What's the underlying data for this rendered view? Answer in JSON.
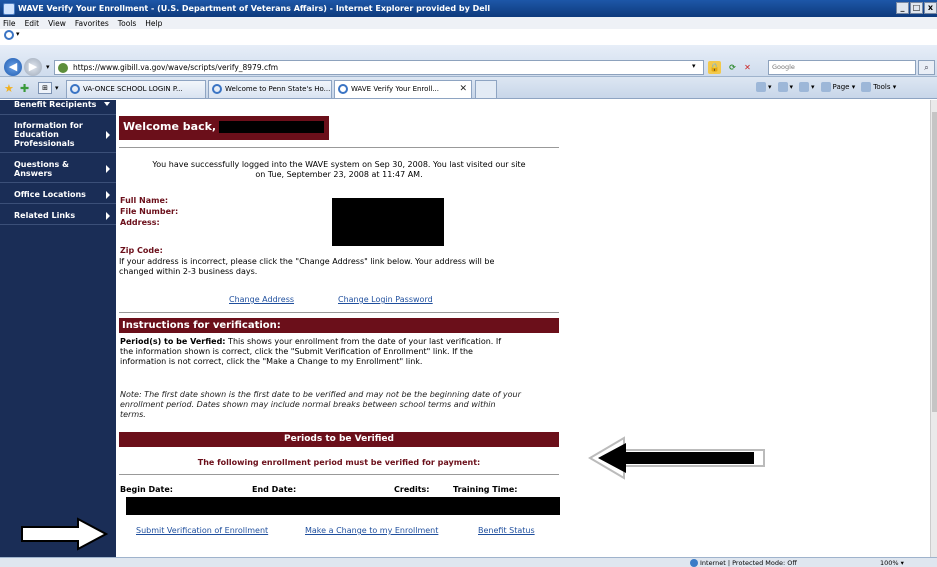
{
  "window": {
    "title": "WAVE Verify Your Enrollment - (U.S. Department of Veterans Affairs) - Internet Explorer provided by Dell",
    "controls": [
      "_",
      "□",
      "x"
    ]
  },
  "menu": [
    "File",
    "Edit",
    "View",
    "Favorites",
    "Tools",
    "Help"
  ],
  "address": {
    "url": "https://www.gibill.va.gov/wave/scripts/verify_8979.cfm",
    "search_placeholder": "Google"
  },
  "tabs": [
    {
      "label": "VA-ONCE SCHOOL LOGIN P...",
      "active": false
    },
    {
      "label": "Welcome to Penn State's Ho...",
      "active": false
    },
    {
      "label": "WAVE Verify Your Enroll...",
      "active": true
    }
  ],
  "command_bar": {
    "page": "Page",
    "tools": "Tools"
  },
  "sidebar": {
    "items": [
      {
        "label": "Benefit Recipients"
      },
      {
        "label": "Information for Education Professionals"
      },
      {
        "label": "Questions & Answers"
      },
      {
        "label": "Office Locations"
      },
      {
        "label": "Related Links"
      }
    ]
  },
  "content": {
    "welcome": "Welcome back,",
    "login_msg_1": "You have successfully logged into the WAVE system on Sep 30, 2008. You last visited our site",
    "login_msg_2": "on Tue, September 23, 2008 at 11:47 AM.",
    "full_name": "Full Name:",
    "file_number": "File Number:",
    "address": "Address:",
    "zip_code": "Zip Code:",
    "incorrect_1": "If your address is incorrect, please click the \"Change Address\" link below. Your address will be",
    "incorrect_2": "changed within 2-3 business days.",
    "change_address": "Change Address",
    "change_password": "Change Login Password",
    "instructions_title": "Instructions for verification:",
    "period_label": "Period(s) to be Verfied:",
    "period_text_1": " This shows your enrollment from the date of your last verification. If",
    "period_text_2": "the information shown is correct, click the \"Submit Verification of Enrollment\" link. If the",
    "period_text_3": "information is not correct, click the \"Make a Change to my Enrollment\" link.",
    "note_1": "Note: The first date shown is the first date to be verified and may not be the beginning date of your",
    "note_2": "enrollment period. Dates shown may include normal breaks between school terms and within",
    "note_3": "terms.",
    "periods_title": "Periods to be Verified",
    "must_verify": "The following enrollment period must be verified for payment:",
    "col_begin": "Begin Date:",
    "col_end": "End Date:",
    "col_credits": "Credits:",
    "col_training": "Training Time:",
    "submit": "Submit Verification of Enrollment",
    "make_change": "Make a Change to my Enrollment",
    "benefit_status": "Benefit Status"
  },
  "status": {
    "zone": "Internet | Protected Mode: Off",
    "zoom": "100%"
  },
  "colors": {
    "maroon": "#6b0f1a",
    "nav_bg": "#1a2d56",
    "link": "#1f4f9e"
  }
}
